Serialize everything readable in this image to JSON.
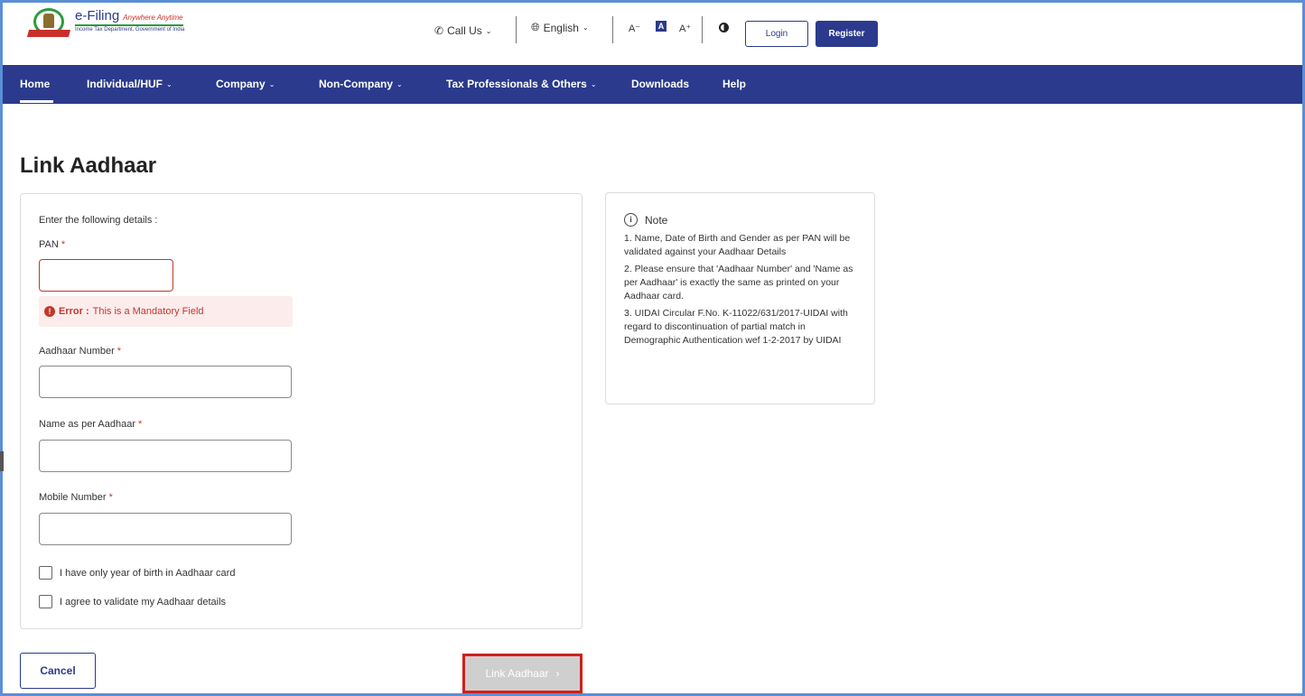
{
  "header": {
    "brand_name": "e-Filing",
    "brand_tagline": "Anywhere Anytime",
    "brand_dept": "Income Tax Department, Government of India",
    "call_us": "Call Us",
    "language": "English",
    "font_decrease": "A⁻",
    "font_normal": "A",
    "font_increase": "A⁺",
    "login": "Login",
    "register": "Register"
  },
  "nav": {
    "items": [
      {
        "label": "Home"
      },
      {
        "label": "Individual/HUF"
      },
      {
        "label": "Company"
      },
      {
        "label": "Non-Company"
      },
      {
        "label": "Tax Professionals & Others"
      },
      {
        "label": "Downloads"
      },
      {
        "label": "Help"
      }
    ],
    "active": "Home"
  },
  "page": {
    "title": "Link Aadhaar"
  },
  "form": {
    "intro": "Enter the following details :",
    "required_mark": "*",
    "pan_label": "PAN",
    "pan_value": "",
    "error_prefix": "Error :",
    "error_text": " This is a Mandatory Field",
    "aadhaar_label": "Aadhaar Number",
    "aadhaar_value": "",
    "name_label": "Name as per Aadhaar",
    "name_value": "",
    "mobile_label": "Mobile Number",
    "mobile_value": "",
    "chk_year_label": "I have only year of birth in Aadhaar card",
    "chk_agree_label": "I agree to validate my Aadhaar details"
  },
  "note": {
    "title": "Note",
    "items": [
      "1. Name, Date of Birth and Gender as per PAN will be validated against your Aadhaar Details",
      "2. Please ensure that 'Aadhaar Number' and 'Name as per Aadhaar' is exactly the same as printed on your Aadhaar card.",
      "3. UIDAI Circular F.No. K-11022/631/2017-UIDAI with regard to discontinuation of partial match in Demographic Authentication wef 1-2-2017 by UIDAI"
    ]
  },
  "actions": {
    "cancel": "Cancel",
    "submit": "Link Aadhaar",
    "submit_arrow": "›"
  },
  "colors": {
    "primary": "#2b3a8c",
    "error": "#c0392b",
    "highlight_border": "#d0201b"
  }
}
